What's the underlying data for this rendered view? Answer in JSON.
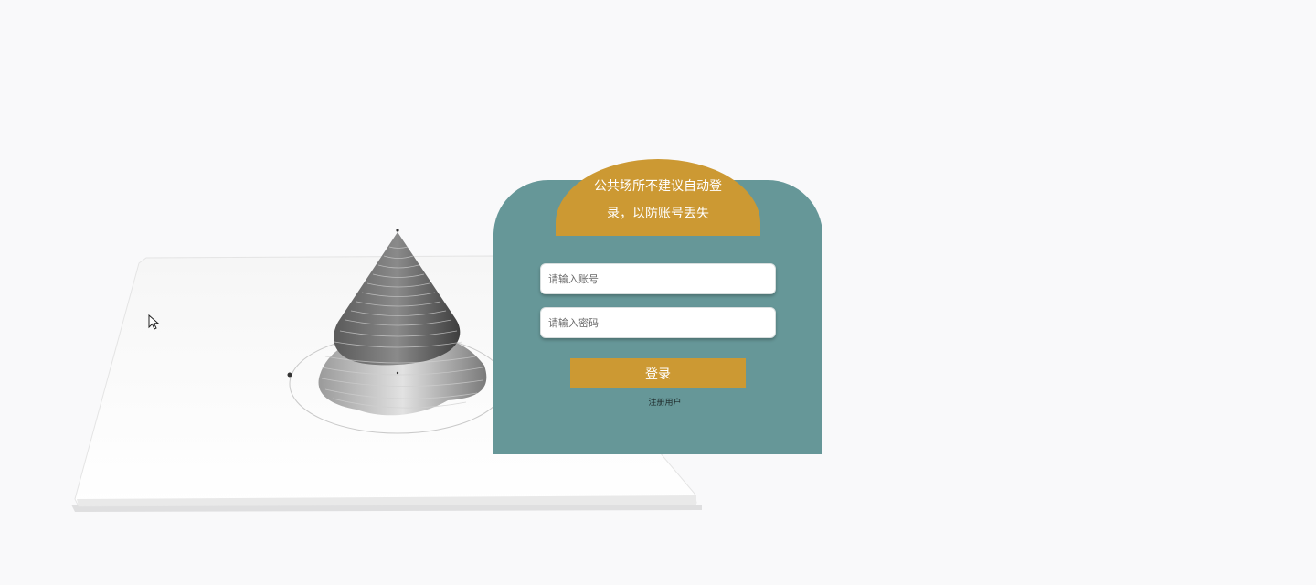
{
  "notice": {
    "text": "公共场所不建议自动登录，以防账号丢失"
  },
  "login_form": {
    "account_placeholder": "请输入账号",
    "password_placeholder": "请输入密码",
    "account_value": "",
    "password_value": "",
    "login_label": "登录",
    "register_label": "注册用户"
  },
  "colors": {
    "panel": "#669798",
    "accent": "#cc9933",
    "background": "#f9f9fa"
  },
  "icons": {
    "cursor": "mouse-pointer-icon",
    "illustration": "terrain-sculpture-illustration"
  }
}
